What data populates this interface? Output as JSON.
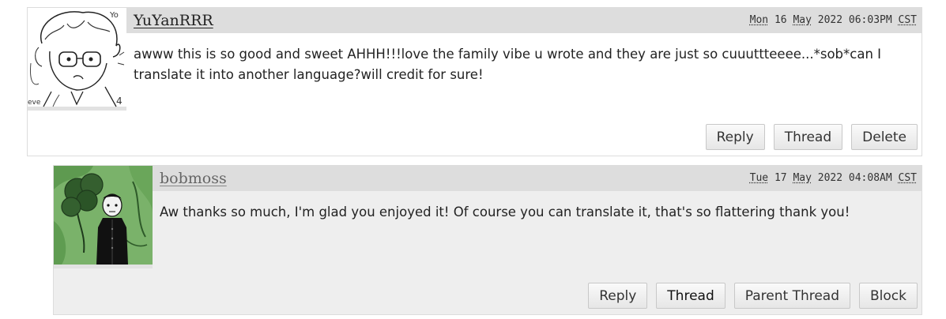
{
  "comments": [
    {
      "author": "YuYanRRR",
      "date": {
        "dow": "Mon",
        "day": "16",
        "month": "May",
        "year": "2022",
        "time": "06:03PM",
        "tz": "CST"
      },
      "text": "awww this is so good and sweet AHHH!!!love the family vibe u wrote and they are just so cuuuttteeee...*sob*can I translate it into another language?will credit for sure!",
      "actions": [
        "Reply",
        "Thread",
        "Delete"
      ],
      "avatar_icon": "sketch-boy-avatar-icon"
    },
    {
      "author": "bobmoss",
      "date": {
        "dow": "Tue",
        "day": "17",
        "month": "May",
        "year": "2022",
        "time": "04:08AM",
        "tz": "CST"
      },
      "text": "Aw thanks so much, I'm glad you enjoyed it! Of course you can translate it, that's so flattering thank you!",
      "actions": [
        "Reply",
        "Thread",
        "Parent Thread",
        "Block"
      ],
      "avatar_icon": "green-broccoli-avatar-icon"
    }
  ],
  "colors": {
    "header_bg": "#dddddd",
    "reply_bg": "#eeeeee",
    "avatar2_green": "#7ab26a"
  }
}
